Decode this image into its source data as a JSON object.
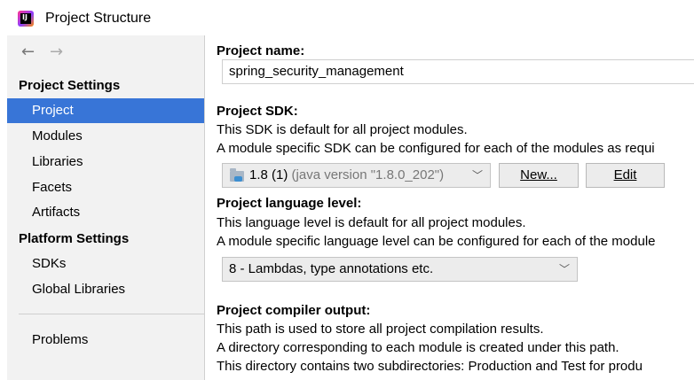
{
  "window": {
    "title": "Project Structure",
    "app_icon_glyph": "IJ"
  },
  "nav": {
    "back_arrow": "←",
    "forward_arrow": "→",
    "groups": [
      {
        "label": "Project Settings"
      },
      {
        "label": "Platform Settings"
      }
    ],
    "project_settings_items": [
      "Project",
      "Modules",
      "Libraries",
      "Facets",
      "Artifacts"
    ],
    "platform_settings_items": [
      "SDKs",
      "Global Libraries"
    ],
    "problems": "Problems",
    "selected": "Project"
  },
  "content": {
    "project_name_label": "Project name:",
    "project_name_value": "spring_security_management",
    "sdk_label": "Project SDK:",
    "sdk_desc_1": "This SDK is default for all project modules.",
    "sdk_desc_2": "A module specific SDK can be configured for each of the modules as requi",
    "sdk_value_main": "1.8 (1)",
    "sdk_value_sub": "(java version \"1.8.0_202\")",
    "new_button": "New...",
    "edit_button": "Edit",
    "lang_label": "Project language level:",
    "lang_desc_1": "This language level is default for all project modules.",
    "lang_desc_2": "A module specific language level can be configured for each of the module",
    "lang_value": "8 - Lambdas, type annotations etc.",
    "compiler_label": "Project compiler output:",
    "compiler_desc_1": "This path is used to store all project compilation results.",
    "compiler_desc_2": "A directory corresponding to each module is created under this path.",
    "compiler_desc_3": "This directory contains two subdirectories: Production and Test for produ"
  },
  "colors": {
    "selection": "#3875d7",
    "sidebar_bg": "#f2f2f2",
    "button_bg": "#ececec"
  }
}
